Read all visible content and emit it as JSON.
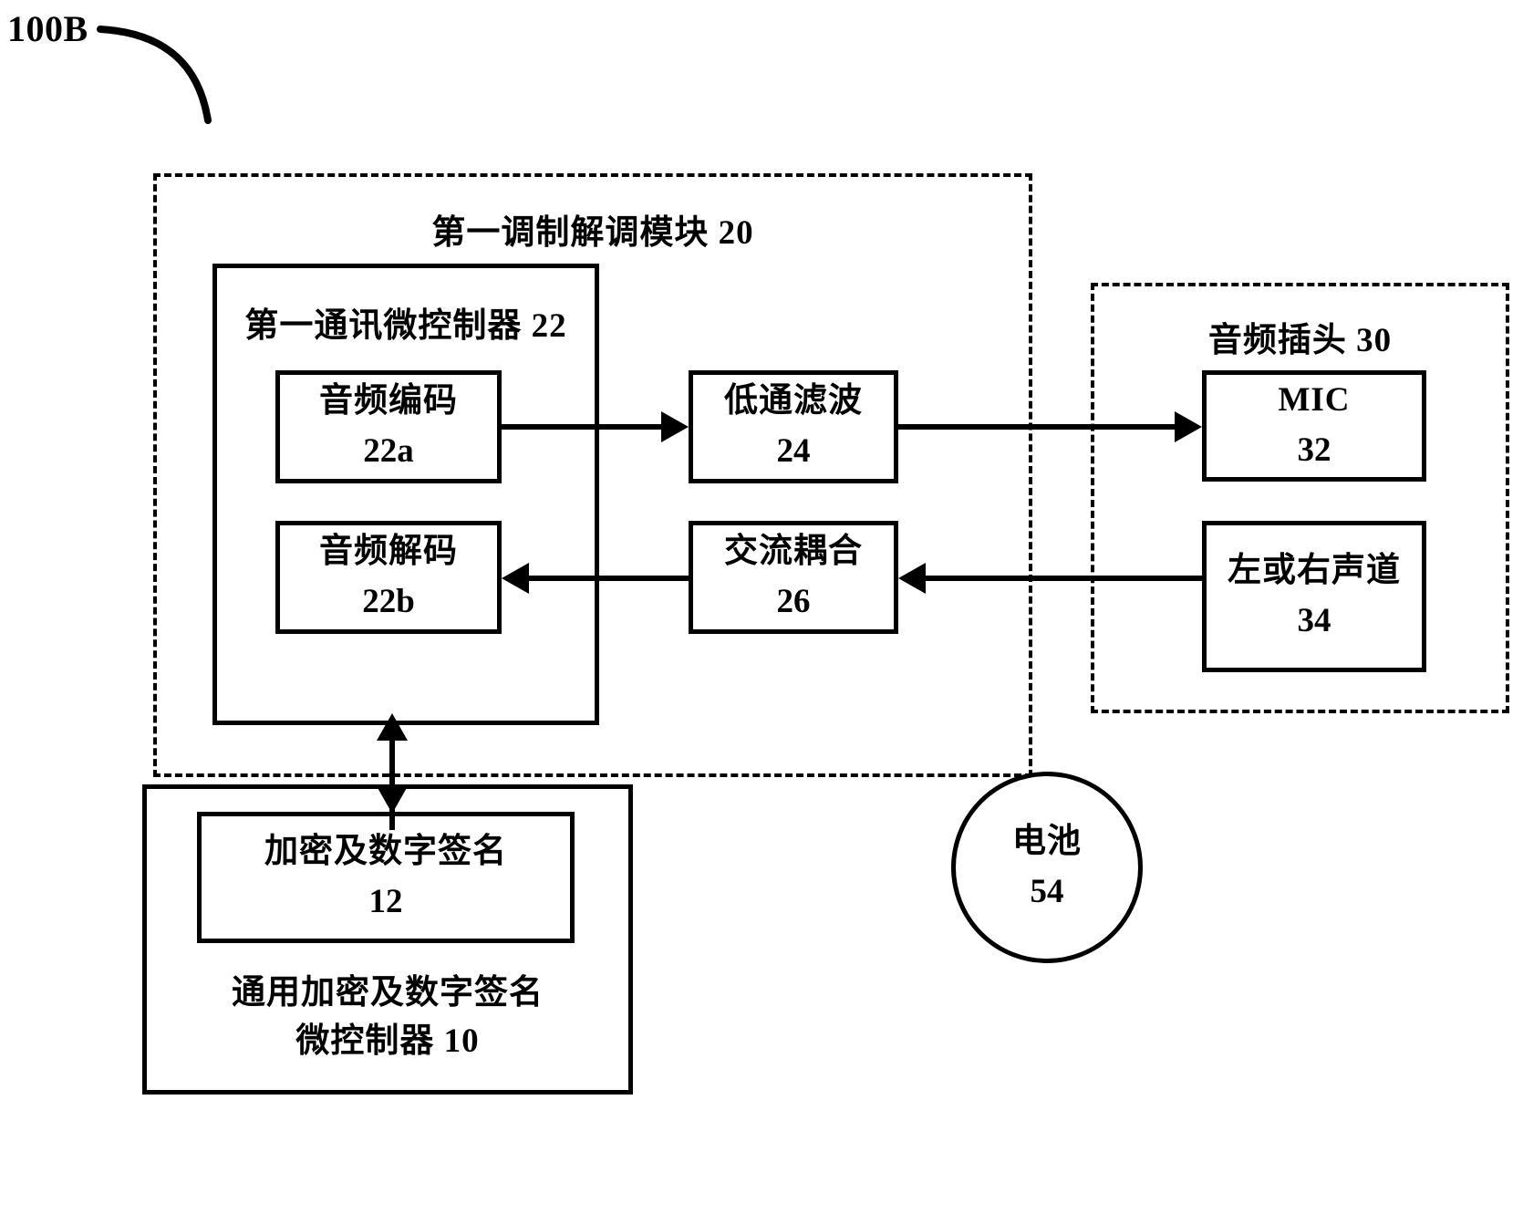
{
  "figure": {
    "reference_label": "100B",
    "leader_line": "curved-leader-line"
  },
  "groups": {
    "modem_module": {
      "title": "第一调制解调模块  20",
      "label": "第一调制解调模块",
      "number": "20"
    },
    "audio_jack": {
      "title": "音频插头  30",
      "label": "音频插头",
      "number": "30"
    }
  },
  "boxes": {
    "comm_mcu": {
      "title": "第一通讯微控制器  22",
      "label": "第一通讯微控制器",
      "number": "22"
    },
    "audio_encode": {
      "label": "音频编码",
      "number": "22a"
    },
    "audio_decode": {
      "label": "音频解码",
      "number": "22b"
    },
    "low_pass_filter": {
      "label": "低通滤波",
      "number": "24"
    },
    "ac_coupling": {
      "label": "交流耦合",
      "number": "26"
    },
    "mic": {
      "label": "MIC",
      "number": "32"
    },
    "left_right_channel": {
      "label": "左或右声道",
      "number": "34"
    },
    "encryption_signature": {
      "label": "加密及数字签名",
      "number": "12"
    },
    "generic_crypto_mcu": {
      "line1": "通用加密及数字签名",
      "line2": "微控制器    10",
      "label": "通用加密及数字签名微控制器",
      "number": "10"
    },
    "battery": {
      "label": "电池",
      "number": "54"
    }
  },
  "connectors": [
    {
      "name": "encode-to-lpf",
      "from": "audio_encode",
      "to": "low_pass_filter",
      "direction": "right"
    },
    {
      "name": "lpf-to-mic",
      "from": "low_pass_filter",
      "to": "mic",
      "direction": "right"
    },
    {
      "name": "channel-to-ac-coupling",
      "from": "left_right_channel",
      "to": "ac_coupling",
      "direction": "left"
    },
    {
      "name": "ac-coupling-to-decode",
      "from": "ac_coupling",
      "to": "audio_decode",
      "direction": "left"
    },
    {
      "name": "crypto-mcu-to-comm-mcu",
      "from": "generic_crypto_mcu",
      "to": "comm_mcu",
      "direction": "bidirectional-vertical"
    }
  ],
  "style": {
    "stroke": "#000000",
    "background": "#ffffff"
  }
}
